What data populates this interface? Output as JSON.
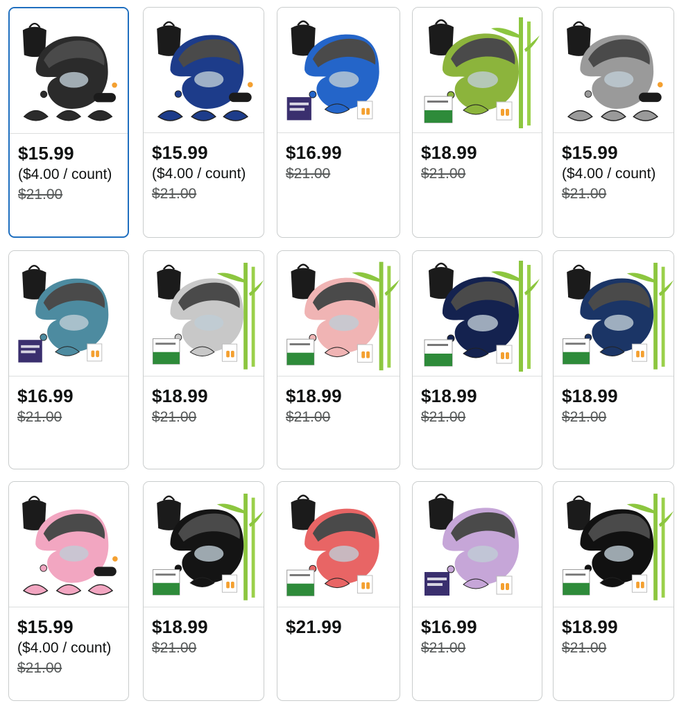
{
  "variants": [
    {
      "price": "$15.99",
      "unit": "($4.00 / count)",
      "list": "$21.00",
      "color": "#2b2b2b",
      "bamboo": false,
      "selected": true,
      "box": "none",
      "accessory": "tri"
    },
    {
      "price": "$15.99",
      "unit": "($4.00 / count)",
      "list": "$21.00",
      "color": "#1d3c8a",
      "bamboo": false,
      "selected": false,
      "box": "none",
      "accessory": "tri"
    },
    {
      "price": "$16.99",
      "unit": "",
      "list": "$21.00",
      "color": "#2465c9",
      "bamboo": false,
      "selected": false,
      "box": "sleep",
      "accessory": "mask"
    },
    {
      "price": "$18.99",
      "unit": "",
      "list": "$21.00",
      "color": "#8cb43c",
      "bamboo": true,
      "selected": false,
      "box": "memory",
      "accessory": "mask"
    },
    {
      "price": "$15.99",
      "unit": "($4.00 / count)",
      "list": "$21.00",
      "color": "#9a9a9a",
      "bamboo": false,
      "selected": false,
      "box": "none",
      "accessory": "tri"
    },
    {
      "price": "$16.99",
      "unit": "",
      "list": "$21.00",
      "color": "#4d8ba0",
      "bamboo": false,
      "selected": false,
      "box": "sleep",
      "accessory": "mask"
    },
    {
      "price": "$18.99",
      "unit": "",
      "list": "$21.00",
      "color": "#c8c8c8",
      "bamboo": true,
      "selected": false,
      "box": "memory",
      "accessory": "mask"
    },
    {
      "price": "$18.99",
      "unit": "",
      "list": "$21.00",
      "color": "#f0b4b4",
      "bamboo": true,
      "selected": false,
      "box": "memory",
      "accessory": "mask"
    },
    {
      "price": "$18.99",
      "unit": "",
      "list": "$21.00",
      "color": "#14224f",
      "bamboo": true,
      "selected": false,
      "box": "memory",
      "accessory": "mask"
    },
    {
      "price": "$18.99",
      "unit": "",
      "list": "$21.00",
      "color": "#1b3566",
      "bamboo": true,
      "selected": false,
      "box": "memory",
      "accessory": "mask"
    },
    {
      "price": "$15.99",
      "unit": "($4.00 / count)",
      "list": "$21.00",
      "color": "#f2a6c1",
      "bamboo": false,
      "selected": false,
      "box": "none",
      "accessory": "tri"
    },
    {
      "price": "$18.99",
      "unit": "",
      "list": "$21.00",
      "color": "#141414",
      "bamboo": true,
      "selected": false,
      "box": "memory",
      "accessory": "mask"
    },
    {
      "price": "$21.99",
      "unit": "",
      "list": "",
      "color": "#e86565",
      "bamboo": false,
      "selected": false,
      "box": "memory",
      "accessory": "mask"
    },
    {
      "price": "$16.99",
      "unit": "",
      "list": "$21.00",
      "color": "#c6a6d8",
      "bamboo": false,
      "selected": false,
      "box": "sleep",
      "accessory": "mask"
    },
    {
      "price": "$18.99",
      "unit": "",
      "list": "$21.00",
      "color": "#111111",
      "bamboo": true,
      "selected": false,
      "box": "memory",
      "accessory": "mask"
    }
  ]
}
